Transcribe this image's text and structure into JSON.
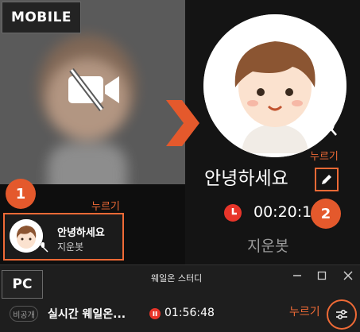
{
  "mobile": {
    "badge": "MOBILE",
    "step1": "1",
    "step2": "2",
    "press_label_left": "누르기",
    "press_label_top": "누르기",
    "participant_card": {
      "name": "안녕하세요",
      "group": "지운봇"
    },
    "profile": {
      "name": "안녕하세요",
      "timer": "00:20:1",
      "group": "지운봇"
    },
    "icons": [
      "video-off-icon",
      "arrow-right-icon",
      "mic-off-icon",
      "pencil-icon",
      "timer-icon"
    ]
  },
  "pc": {
    "badge": "PC",
    "window_title": "웨일온 스터디",
    "privacy": "비공개",
    "study_title": "실시간 웨일온...",
    "timer": "01:56:48",
    "press_label": "누르기",
    "icons": [
      "minimize-icon",
      "maximize-icon",
      "close-icon",
      "record-icon",
      "settings-sliders-icon"
    ]
  },
  "colors": {
    "accent": "#ef6a36",
    "badge": "#e4592c",
    "bg": "#141414"
  }
}
